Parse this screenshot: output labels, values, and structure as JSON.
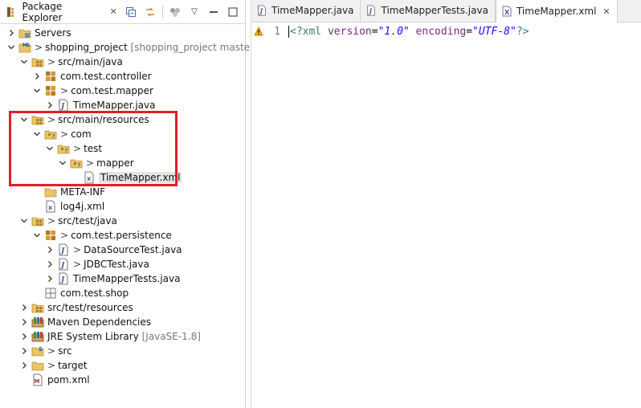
{
  "explorer": {
    "title": "Package Explorer",
    "close_glyph": "✕",
    "tools": [
      "collapse-all-icon",
      "link-editor-icon",
      "focus-task-icon",
      "view-menu-icon"
    ],
    "menu_glyph": "▽"
  },
  "tree": [
    {
      "label": "Servers",
      "deco": "",
      "prefix": "",
      "depth": 0,
      "twist": "collapsed",
      "icon": "folder-servers-icon"
    },
    {
      "label": "shopping_project",
      "deco": " [shopping_project master]",
      "prefix": ">",
      "depth": 0,
      "twist": "expanded",
      "icon": "maven-project-icon"
    },
    {
      "label": "src/main/java",
      "deco": "",
      "prefix": ">",
      "depth": 1,
      "twist": "expanded",
      "icon": "source-folder-icon"
    },
    {
      "label": "com.test.controller",
      "deco": "",
      "prefix": "",
      "depth": 2,
      "twist": "collapsed",
      "icon": "package-icon"
    },
    {
      "label": "com.test.mapper",
      "deco": "",
      "prefix": ">",
      "depth": 2,
      "twist": "expanded",
      "icon": "package-icon"
    },
    {
      "label": "TimeMapper.java",
      "deco": "",
      "prefix": "",
      "depth": 3,
      "twist": "collapsed",
      "icon": "java-interface-icon"
    },
    {
      "label": "src/main/resources",
      "deco": "",
      "prefix": ">",
      "depth": 1,
      "twist": "expanded",
      "icon": "source-folder-icon"
    },
    {
      "label": "com",
      "deco": "",
      "prefix": ">",
      "depth": 2,
      "twist": "expanded",
      "icon": "folder-unknown-icon"
    },
    {
      "label": "test",
      "deco": "",
      "prefix": ">",
      "depth": 3,
      "twist": "expanded",
      "icon": "folder-unknown-icon"
    },
    {
      "label": "mapper",
      "deco": "",
      "prefix": ">",
      "depth": 4,
      "twist": "expanded",
      "icon": "folder-unknown-icon"
    },
    {
      "label": "TimeMapper.xml",
      "deco": "",
      "prefix": "",
      "depth": 5,
      "twist": "none",
      "icon": "xml-file-icon",
      "selected": true
    },
    {
      "label": "META-INF",
      "deco": "",
      "prefix": "",
      "depth": 2,
      "twist": "none",
      "icon": "folder-icon"
    },
    {
      "label": "log4j.xml",
      "deco": "",
      "prefix": "",
      "depth": 2,
      "twist": "none",
      "icon": "xml-file-icon"
    },
    {
      "label": "src/test/java",
      "deco": "",
      "prefix": ">",
      "depth": 1,
      "twist": "expanded",
      "icon": "source-folder-icon"
    },
    {
      "label": "com.test.persistence",
      "deco": "",
      "prefix": ">",
      "depth": 2,
      "twist": "expanded",
      "icon": "package-icon"
    },
    {
      "label": "DataSourceTest.java",
      "deco": "",
      "prefix": ">",
      "depth": 3,
      "twist": "collapsed",
      "icon": "java-file-icon"
    },
    {
      "label": "JDBCTest.java",
      "deco": "",
      "prefix": ">",
      "depth": 3,
      "twist": "collapsed",
      "icon": "java-file-icon"
    },
    {
      "label": "TimeMapperTests.java",
      "deco": "",
      "prefix": "",
      "depth": 3,
      "twist": "collapsed",
      "icon": "java-file-icon"
    },
    {
      "label": "com.test.shop",
      "deco": "",
      "prefix": "",
      "depth": 2,
      "twist": "none",
      "icon": "empty-package-icon"
    },
    {
      "label": "src/test/resources",
      "deco": "",
      "prefix": "",
      "depth": 1,
      "twist": "collapsed",
      "icon": "source-folder-icon"
    },
    {
      "label": "Maven Dependencies",
      "deco": "",
      "prefix": "",
      "depth": 1,
      "twist": "collapsed",
      "icon": "library-icon"
    },
    {
      "label": "JRE System Library",
      "deco": " [JavaSE-1.8]",
      "prefix": "",
      "depth": 1,
      "twist": "collapsed",
      "icon": "library-icon"
    },
    {
      "label": "src",
      "deco": "",
      "prefix": ">",
      "depth": 1,
      "twist": "collapsed",
      "icon": "folder-src-icon"
    },
    {
      "label": "target",
      "deco": "",
      "prefix": ">",
      "depth": 1,
      "twist": "collapsed",
      "icon": "folder-icon"
    },
    {
      "label": "pom.xml",
      "deco": "",
      "prefix": "",
      "depth": 1,
      "twist": "none",
      "icon": "maven-pom-icon"
    }
  ],
  "editor": {
    "tabs": [
      {
        "label": "TimeMapper.java",
        "icon": "java-interface-icon",
        "active": false
      },
      {
        "label": "TimeMapperTests.java",
        "icon": "java-file-icon",
        "active": false
      },
      {
        "label": "TimeMapper.xml",
        "icon": "xml-tab-icon",
        "active": true
      }
    ],
    "close_glyph": "✕",
    "line_number": "1",
    "code": {
      "pi_open": "<?xml",
      "attr1": " version",
      "eq1": "=",
      "val1": "\"1.0\"",
      "attr2": " encoding",
      "eq2": "=",
      "val2": "\"UTF-8\"",
      "pi_close": "?>"
    }
  },
  "colors": {
    "highlight": "#e01f2a",
    "folder": "#e8c46a",
    "package": "#b07a2a",
    "source": "#8c6a2a",
    "java_blue": "#3b5fa8",
    "warning": "#f2b200"
  }
}
